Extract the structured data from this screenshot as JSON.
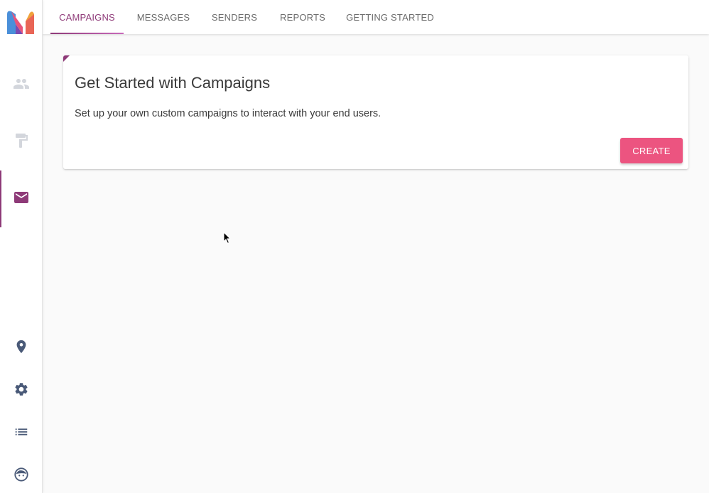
{
  "sidebar": {
    "logo_name": "m-logo",
    "items": [
      {
        "icon": "people-icon",
        "active": false
      },
      {
        "icon": "paint-roller-icon",
        "active": false
      },
      {
        "icon": "mail-icon",
        "active": true
      }
    ],
    "bottom_items": [
      {
        "icon": "location-pin-icon"
      },
      {
        "icon": "gear-icon"
      },
      {
        "icon": "list-icon"
      },
      {
        "icon": "face-icon"
      }
    ]
  },
  "tabs": [
    {
      "label": "CAMPAIGNS",
      "active": true
    },
    {
      "label": "MESSAGES",
      "active": false
    },
    {
      "label": "SENDERS",
      "active": false
    },
    {
      "label": "REPORTS",
      "active": false
    },
    {
      "label": "GETTING STARTED",
      "active": false
    }
  ],
  "card": {
    "title": "Get Started with Campaigns",
    "description": "Set up your own custom campaigns to interact with your end users.",
    "create_label": "CREATE"
  },
  "colors": {
    "accent": "#8e3a78",
    "button": "#ec5480",
    "icon_inactive": "#d3d6dc",
    "icon_bottom": "#4a5a78"
  }
}
